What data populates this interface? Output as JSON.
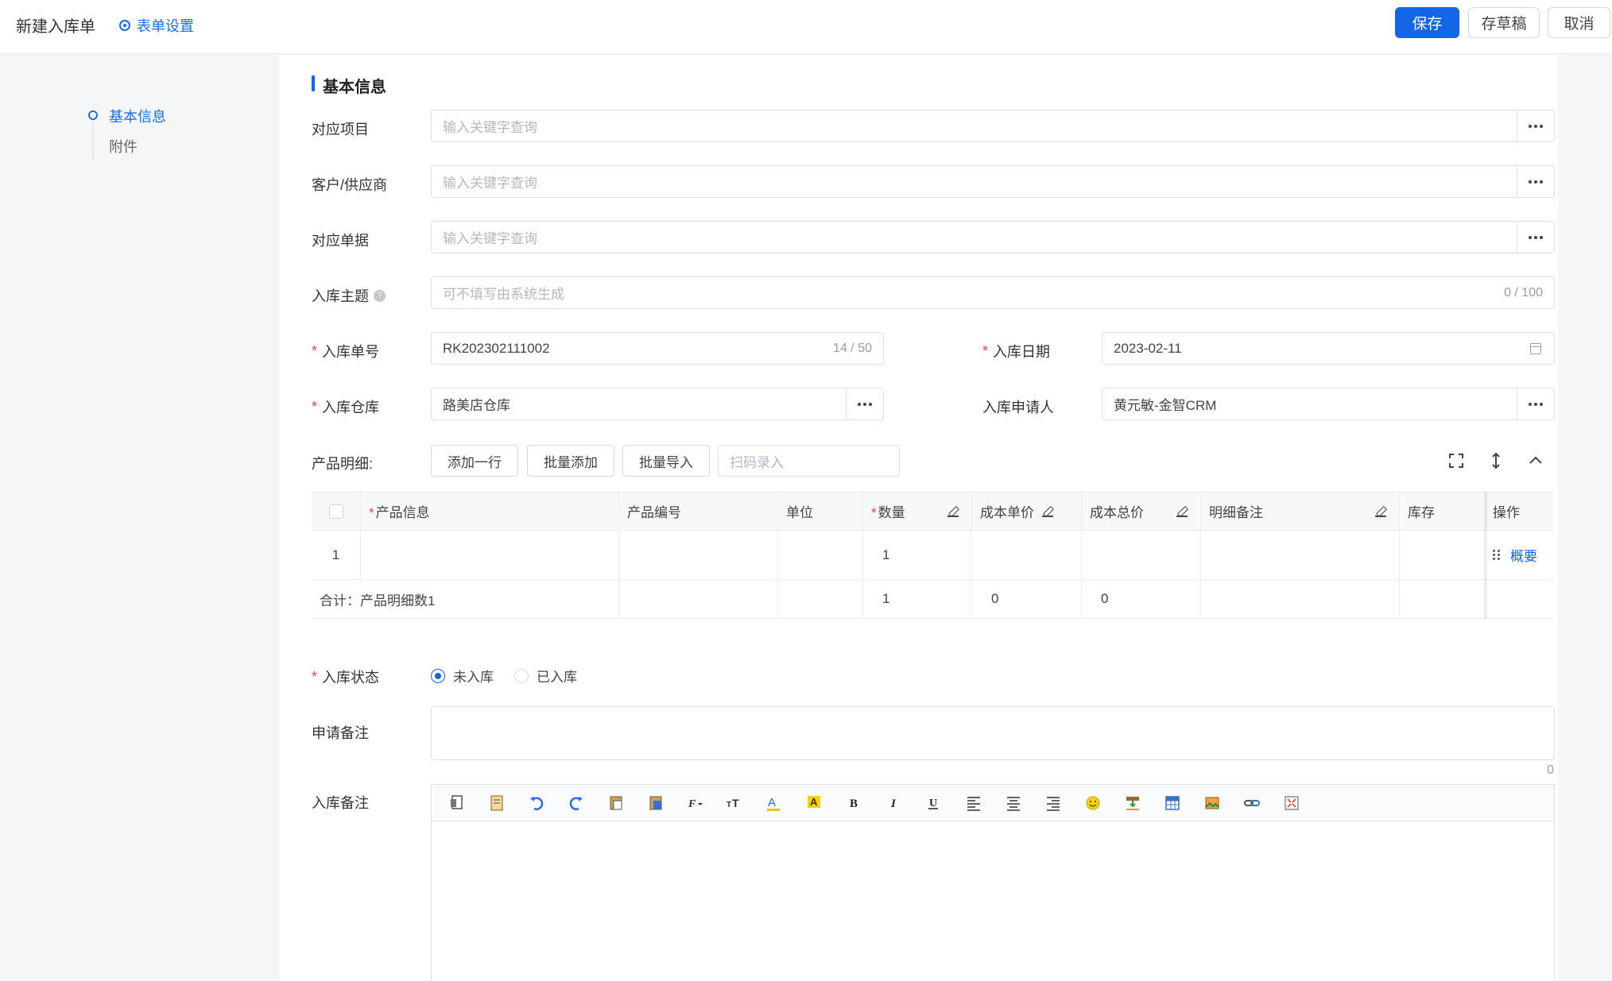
{
  "header": {
    "title": "新建入库单",
    "form_settings": "表单设置",
    "save": "保存",
    "draft": "存草稿",
    "cancel": "取消"
  },
  "sidenav": {
    "items": [
      {
        "label": "基本信息",
        "active": true
      },
      {
        "label": "附件",
        "active": false
      }
    ]
  },
  "section": {
    "title": "基本信息"
  },
  "fields": {
    "project": {
      "label": "对应项目",
      "placeholder": "输入关键字查询"
    },
    "customer": {
      "label": "客户/供应商",
      "placeholder": "输入关键字查询"
    },
    "document": {
      "label": "对应单据",
      "placeholder": "输入关键字查询"
    },
    "subject": {
      "label": "入库主题",
      "placeholder": "可不填写由系统生成",
      "count": "0 / 100"
    },
    "number": {
      "label": "入库单号",
      "value": "RK202302111002",
      "count": "14 / 50"
    },
    "date": {
      "label": "入库日期",
      "value": "2023-02-11"
    },
    "warehouse": {
      "label": "入库仓库",
      "value": "路美店仓库"
    },
    "applicant": {
      "label": "入库申请人",
      "value": "黄元敏-金智CRM"
    }
  },
  "product": {
    "label": "产品明细:",
    "add_row": "添加一行",
    "batch_add": "批量添加",
    "batch_import": "批量导入",
    "scan_placeholder": "扫码录入"
  },
  "table": {
    "headers": [
      "产品信息",
      "产品编号",
      "单位",
      "数量",
      "成本单价",
      "成本总价",
      "明细备注",
      "库存",
      "操作"
    ],
    "row1": {
      "index": "1",
      "qty": "1",
      "action": "概要"
    },
    "total": {
      "label": "合计：产品明细数1",
      "qty": "1",
      "unit_cost": "0",
      "total_cost": "0"
    }
  },
  "status": {
    "label": "入库状态",
    "options": [
      "未入库",
      "已入库"
    ],
    "selected": "未入库"
  },
  "apply_note": {
    "label": "申请备注",
    "count": "0"
  },
  "stock_note": {
    "label": "入库备注"
  },
  "colors": {
    "primary": "#1366e8",
    "required": "#e5483c"
  }
}
